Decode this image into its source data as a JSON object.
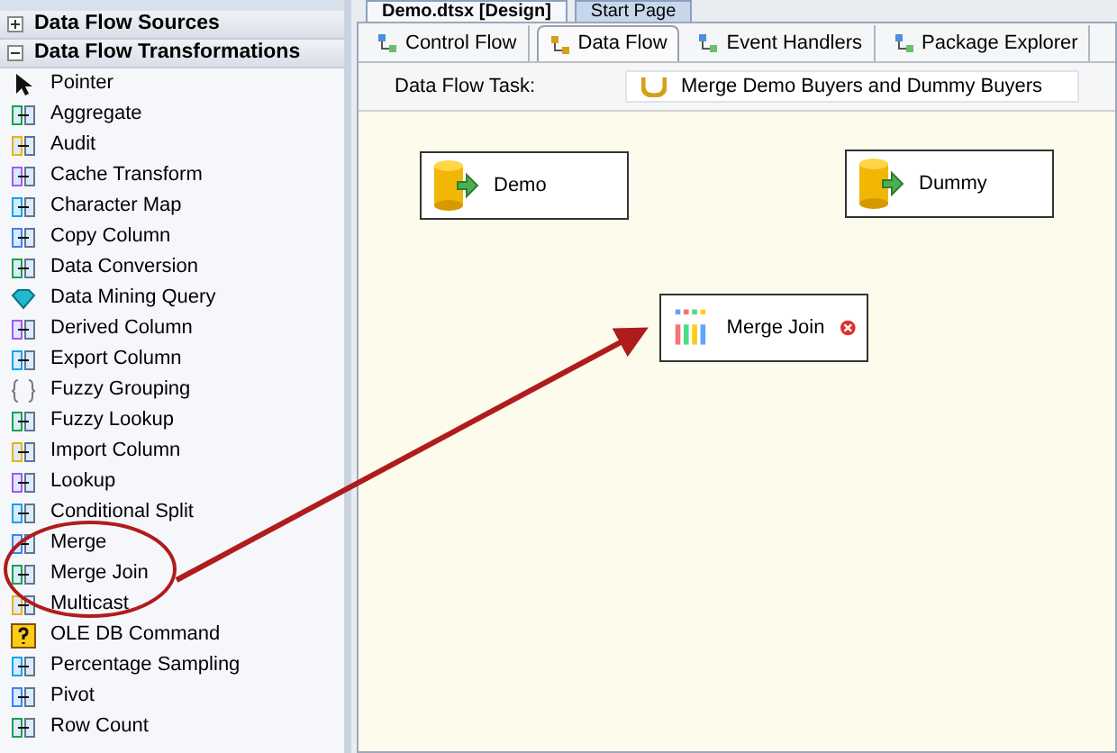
{
  "toolbox": {
    "sections": [
      {
        "label": "Data Flow Sources",
        "expanded": false
      },
      {
        "label": "Data Flow Transformations",
        "expanded": true,
        "items": [
          {
            "label": "Pointer",
            "kind": "pointer"
          },
          {
            "label": "Aggregate",
            "kind": "component"
          },
          {
            "label": "Audit",
            "kind": "component"
          },
          {
            "label": "Cache Transform",
            "kind": "component"
          },
          {
            "label": "Character Map",
            "kind": "component"
          },
          {
            "label": "Copy Column",
            "kind": "component"
          },
          {
            "label": "Data Conversion",
            "kind": "component"
          },
          {
            "label": "Data Mining Query",
            "kind": "gem"
          },
          {
            "label": "Derived Column",
            "kind": "component"
          },
          {
            "label": "Export Column",
            "kind": "component"
          },
          {
            "label": "Fuzzy Grouping",
            "kind": "braces"
          },
          {
            "label": "Fuzzy Lookup",
            "kind": "component"
          },
          {
            "label": "Import Column",
            "kind": "component"
          },
          {
            "label": "Lookup",
            "kind": "component"
          },
          {
            "label": "Conditional Split",
            "kind": "component"
          },
          {
            "label": "Merge",
            "kind": "component"
          },
          {
            "label": "Merge Join",
            "kind": "component"
          },
          {
            "label": "Multicast",
            "kind": "component"
          },
          {
            "label": "OLE DB Command",
            "kind": "command"
          },
          {
            "label": "Percentage Sampling",
            "kind": "component"
          },
          {
            "label": "Pivot",
            "kind": "component"
          },
          {
            "label": "Row Count",
            "kind": "component"
          }
        ]
      }
    ]
  },
  "document_tabs": [
    {
      "label": "Demo.dtsx [Design]",
      "selected": true
    },
    {
      "label": "Start Page",
      "selected": false
    }
  ],
  "designer_tabs": [
    {
      "label": "Control Flow",
      "selected": false
    },
    {
      "label": "Data Flow",
      "selected": true
    },
    {
      "label": "Event Handlers",
      "selected": false
    },
    {
      "label": "Package Explorer",
      "selected": false
    }
  ],
  "task": {
    "label": "Data Flow Task:",
    "value": "Merge Demo Buyers and Dummy Buyers"
  },
  "nodes": [
    {
      "label": "Demo",
      "kind": "source",
      "error": false
    },
    {
      "label": "Dummy",
      "kind": "source",
      "error": false
    },
    {
      "label": "Merge Join",
      "kind": "merge",
      "error": true
    }
  ]
}
